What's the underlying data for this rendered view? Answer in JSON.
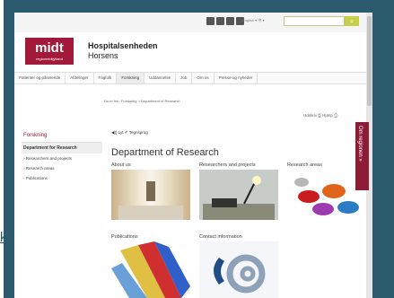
{
  "left_link_text": "k",
  "topbar": {
    "lang_text": "English ▾ 中 ▾",
    "search_placeholder": "",
    "search_button": "⌕"
  },
  "logo": {
    "word": "midt",
    "sub": "regionmidtjylland"
  },
  "site": {
    "name_bold": "Hospitalsenheden",
    "name": "Horsens"
  },
  "nav": [
    "Patienter og pårørende",
    "Afdelinger",
    "Fagfolk",
    "Forskning",
    "Uddannelse",
    "Job",
    "Om os",
    "Presse og nyheder"
  ],
  "nav_active": "Forskning",
  "breadcrumb": "Du er her: Forskning > Department of Research",
  "tools": "Udskriv ⎙     Hjælp ⓘ",
  "sidebar": {
    "title": "Forskning",
    "selected": "Department for Research",
    "items": [
      "› Researchers and projects",
      "› Research areas",
      "› Publications"
    ]
  },
  "listen": "◀)) Lyt    ✐ Tegnsprog",
  "main": {
    "heading": "Department of Research",
    "thumbnails": [
      {
        "label": "About us"
      },
      {
        "label": "Researchers and projects"
      },
      {
        "label": "Research areas"
      },
      {
        "label": "Publications"
      },
      {
        "label": "Contact information"
      }
    ]
  },
  "side_tab": "Om regionen  »",
  "colors": {
    "frame": "#2a5a6c",
    "brand_red": "#a3193a",
    "search_accent": "#c9ce4a"
  }
}
